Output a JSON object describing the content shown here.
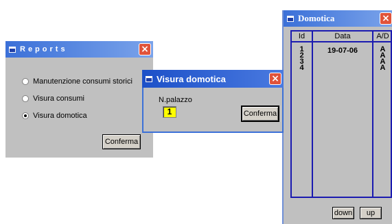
{
  "reports": {
    "title": "Reports",
    "options": [
      {
        "label": "Manutenzione consumi storici",
        "selected": false
      },
      {
        "label": "Visura consumi",
        "selected": false
      },
      {
        "label": "Visura  domotica",
        "selected": true
      }
    ],
    "confirm_label": "Conferma"
  },
  "visura": {
    "title": "Visura domotica",
    "field_label": "N.palazzo",
    "field_value": "1",
    "confirm_label": "Conferma"
  },
  "domotica": {
    "title": "Domotica",
    "headers": [
      "Id",
      "Data",
      "A/D"
    ],
    "ids": [
      "1",
      "2",
      "3",
      "4"
    ],
    "dates": [
      "19-07-06"
    ],
    "ad": [
      "A",
      "A",
      "A",
      "A"
    ],
    "down_label": "down",
    "up_label": "up"
  },
  "colors": {
    "title_bar": "#3b70d8",
    "close_button": "#e0533a",
    "window_bg": "#c0c0c0",
    "grid_lines": "#1a1ab0",
    "input_bg": "#ffff00"
  }
}
